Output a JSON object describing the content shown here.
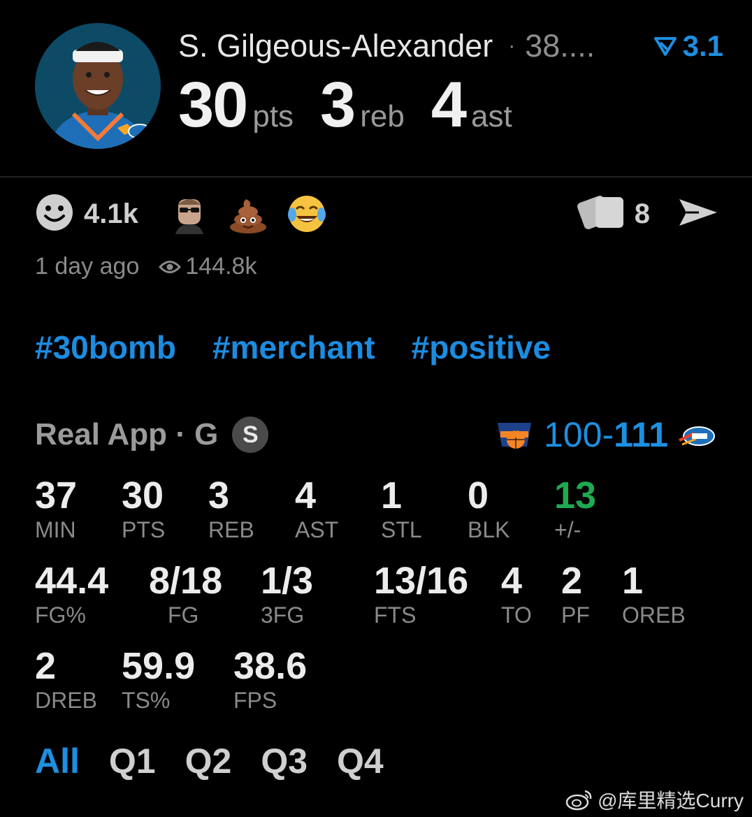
{
  "header": {
    "player_name": "S. Gilgeous-Alexander",
    "separator": "·",
    "detail": "38....",
    "trend_value": "3.1",
    "stats": [
      {
        "num": "30",
        "unit": "pts"
      },
      {
        "num": "3",
        "unit": "reb"
      },
      {
        "num": "4",
        "unit": "ast"
      }
    ]
  },
  "reactions": {
    "like_count": "4.1k",
    "emojis": [
      "person-sunglasses-emoji",
      "poop-emoji",
      "laughing-tears-emoji"
    ],
    "comment_count": "8"
  },
  "meta": {
    "time_ago": "1 day ago",
    "views": "144.8k"
  },
  "hashtags": [
    "#30bomb",
    "#merchant",
    "#positive"
  ],
  "game": {
    "label": "Real App · G",
    "badge": "S",
    "score_away": "100",
    "score_dash": "-",
    "score_home": "111"
  },
  "stats": [
    {
      "value": "37",
      "label": "MIN"
    },
    {
      "value": "30",
      "label": "PTS"
    },
    {
      "value": "3",
      "label": "REB"
    },
    {
      "value": "4",
      "label": "AST"
    },
    {
      "value": "1",
      "label": "STL"
    },
    {
      "value": "0",
      "label": "BLK"
    },
    {
      "value": "13",
      "label": "+/-"
    },
    {
      "value": "44.4",
      "label": "FG%"
    },
    {
      "value": "8/18",
      "label": "FG"
    },
    {
      "value": "1/3",
      "label": "3FG"
    },
    {
      "value": "13/16",
      "label": "FTS"
    },
    {
      "value": "4",
      "label": "TO"
    },
    {
      "value": "2",
      "label": "PF"
    },
    {
      "value": "1",
      "label": "OREB"
    },
    {
      "value": "2",
      "label": "DREB"
    },
    {
      "value": "59.9",
      "label": "TS%"
    },
    {
      "value": "38.6",
      "label": "FPS"
    }
  ],
  "tabs": [
    "All",
    "Q1",
    "Q2",
    "Q3",
    "Q4"
  ],
  "watermark": "@库里精选Curry",
  "colors": {
    "accent_blue": "#1d8fe0",
    "positive_green": "#1eaa52",
    "background": "#000000"
  }
}
